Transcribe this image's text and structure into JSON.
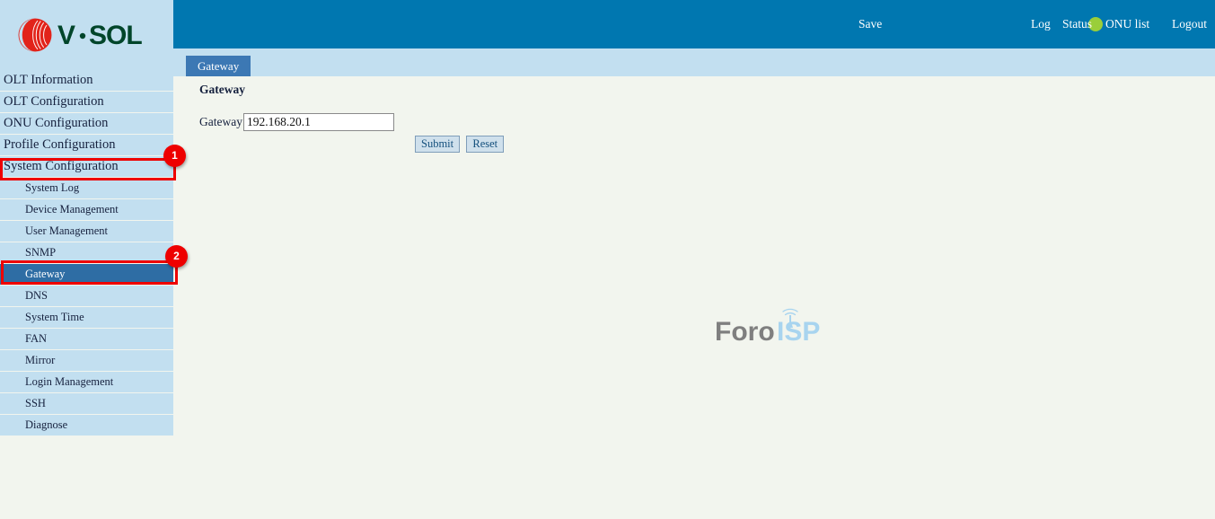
{
  "brand": {
    "name": "V·SOL",
    "logo_icon": "vsol-sphere-logo",
    "logo_red": "#e2231a",
    "logo_text_color": "#004d2e"
  },
  "header": {
    "background": "#0077b0",
    "save_label": "Save",
    "status_dot_icon": "status-dot-icon",
    "status_dot_color": "#9ace3a",
    "links": [
      {
        "label": "Log"
      },
      {
        "label": "Status"
      },
      {
        "label": "ONU list"
      },
      {
        "label": "Logout"
      }
    ]
  },
  "tabbar": {
    "active_tab": "Gateway",
    "tab_color": "#3c78b4",
    "background": "#c2dff0"
  },
  "sidebar": {
    "background": "#c2dff0",
    "active_color": "#2e6da4",
    "top_items": [
      {
        "label": "OLT Information",
        "active": false
      },
      {
        "label": "OLT Configuration",
        "active": false
      },
      {
        "label": "ONU Configuration",
        "active": false
      },
      {
        "label": "Profile Configuration",
        "active": false
      },
      {
        "label": "System Configuration",
        "active": false
      }
    ],
    "sub_items": [
      {
        "label": "System Log",
        "active": false
      },
      {
        "label": "Device Management",
        "active": false
      },
      {
        "label": "User Management",
        "active": false
      },
      {
        "label": "SNMP",
        "active": false
      },
      {
        "label": "Gateway",
        "active": true
      },
      {
        "label": "DNS",
        "active": false
      },
      {
        "label": "System Time",
        "active": false
      },
      {
        "label": "FAN",
        "active": false
      },
      {
        "label": "Mirror",
        "active": false
      },
      {
        "label": "Login Management",
        "active": false
      },
      {
        "label": "SSH",
        "active": false
      },
      {
        "label": "Diagnose",
        "active": false
      }
    ]
  },
  "content": {
    "section_title": "Gateway",
    "form": {
      "gateway_label": "Gateway",
      "gateway_value": "192.168.20.1",
      "gateway_placeholder": ""
    },
    "buttons": {
      "submit_label": "Submit",
      "reset_label": "Reset"
    }
  },
  "watermark": {
    "text_left": "Foro",
    "text_right": "ISP",
    "color_left": "#7f7f7f",
    "color_right": "#a8d4ef",
    "icon": "antenna-tower-icon"
  },
  "annotations": [
    {
      "number": "1",
      "target": "System Configuration",
      "color": "#ee0000"
    },
    {
      "number": "2",
      "target": "Gateway",
      "color": "#ee0000"
    }
  ]
}
